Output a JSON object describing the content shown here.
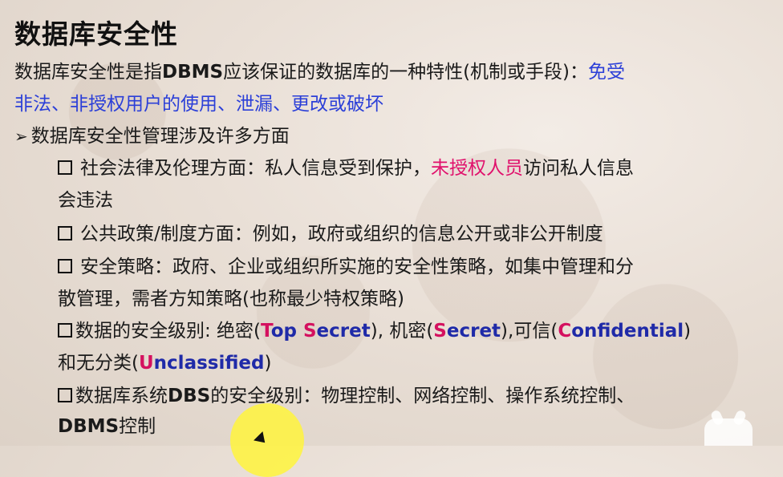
{
  "title": "数据库安全性",
  "intro": {
    "part1": "数据库安全性是指",
    "dbms": "DBMS",
    "part2": "应该保证的数据库的一种特性(机制或手段)：",
    "highlight1": "免受",
    "highlight2": "非法、非授权用户的使用、泄漏、更改或破坏"
  },
  "section": {
    "arrow": "➢",
    "text": "数据库安全性管理涉及许多方面"
  },
  "items": {
    "social": {
      "part1": "社会法律及伦理方面：私人信息受到保护，",
      "highlight": "未授权人员",
      "part2": "访问私人信息",
      "line2": "会违法"
    },
    "policy": {
      "text": "公共政策/制度方面：例如，政府或组织的信息公开或非公开制度"
    },
    "strategy": {
      "line1": "安全策略：政府、企业或组织所实施的安全性策略，如集中管理和分",
      "line2": "散管理，需者方知策略(也称最少特权策略)"
    },
    "levels": {
      "p1": "数据的安全级别: 绝密(",
      "ts_letter": "T",
      "ts_rest": "op ",
      "ts_s": "S",
      "ts_rest2": "ecret",
      "p2": "), 机密(",
      "s_letter": "S",
      "s_rest": "ecret",
      "p3": "),可信(",
      "c_letter": "C",
      "c_rest": "onfidential",
      "p4": ")",
      "line2a": "和无分类(",
      "u_letter": "U",
      "u_rest": "nclassified",
      "line2b": ")"
    },
    "dbs": {
      "p1": "数据库系统",
      "dbs": "DBS",
      "p2": "的安全级别：物理控制、网络控制、操作系统控制、",
      "line2a": "DBMS",
      "line2b": "控制"
    }
  }
}
